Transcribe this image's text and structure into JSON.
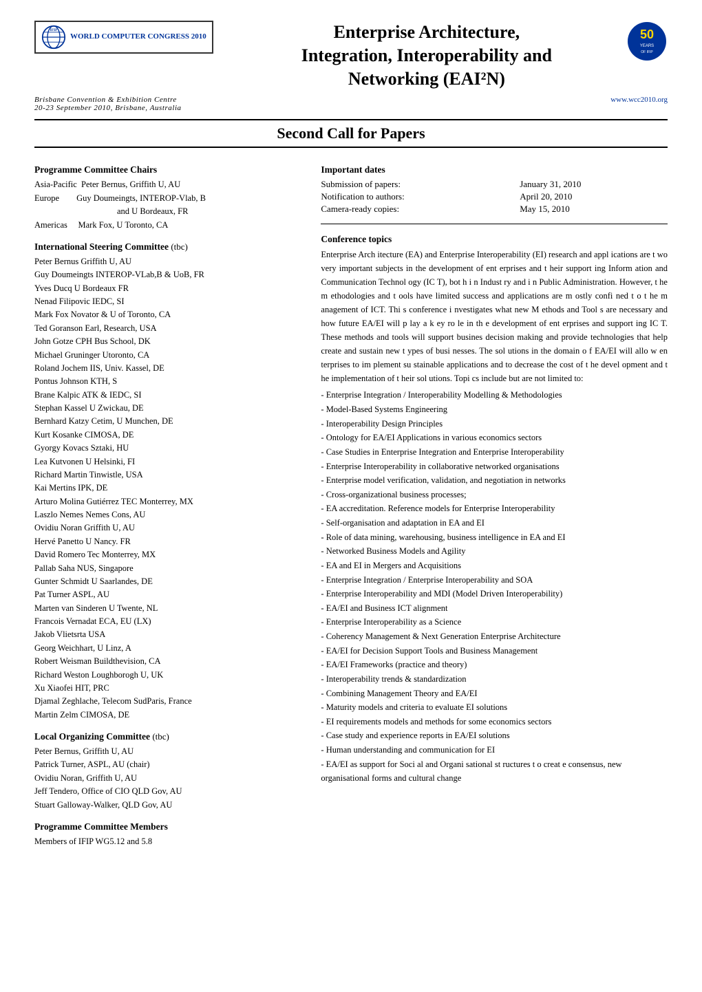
{
  "header": {
    "ifip_label": "IFIP",
    "congress_title": "WORLD COMPUTER CONGRESS 2010",
    "main_title_line1": "Enterprise Architecture,",
    "main_title_line2": "Integration, Interoperability and",
    "main_title_line3": "Networking (EAI²N)",
    "venue_line1": "Brisbane Convention & Exhibition Centre",
    "venue_line2": "20-23 September 2010, Brisbane, Australia",
    "website": "www.wcc2010.org"
  },
  "second_call": {
    "heading": "Second Call for Papers"
  },
  "programme_chairs": {
    "heading": "Programme Committee Chairs",
    "members": [
      "Asia-Pacific  Peter Bernus, Griffith U, AU",
      "Europe        Guy Doumeingts, INTEROP-Vlab, B",
      "              and U Bordeaux, FR",
      "Americas      Mark Fox, U Toronto, CA"
    ]
  },
  "steering_committee": {
    "heading": "International Steering Committee",
    "tbc": "(tbc)",
    "members": [
      "Peter Bernus Griffith U, AU",
      "Guy Doumeingts INTEROP-VLab,B & UoB, FR",
      "Yves Ducq U Bordeaux  FR",
      "Nenad Filipovic IEDC, SI",
      "Mark Fox Novator & U of Toronto, CA",
      "Ted Goranson Earl, Research, USA",
      "John Gotze CPH Bus School, DK",
      "Michael Gruninger Utoronto, CA",
      "Roland Jochem IIS, Univ. Kassel, DE",
      "Pontus Johnson  KTH,  S",
      "Brane Kalpic ATK & IEDC, SI",
      "Stephan Kassel U Zwickau, DE",
      "Bernhard Katzy Cetim, U Munchen, DE",
      "Kurt Kosanke CIMOSA, DE",
      "Gyorgy Kovacs Sztaki, HU",
      "Lea Kutvonen  U Helsinki,  FI",
      "Richard Martin Tinwistle, USA",
      "Kai Mertins IPK, DE",
      "Arturo Molina Gutiérrez TEC Monterrey, MX",
      "Laszlo Nemes Nemes Cons, AU",
      "Ovidiu Noran Griffith U, AU",
      "Hervé Panetto U Nancy. FR",
      "David Romero Tec Monterrey, MX",
      "Pallab Saha NUS, Singapore",
      "Gunter Schmidt U Saarlandes, DE",
      "Pat Turner ASPL, AU",
      "Marten van Sinderen U Twente,  NL",
      "Francois Vernadat ECA, EU (LX)",
      "Jakob Vlietsrta USA",
      "Georg Weichhart, U Linz, A",
      "Robert Weisman Buildthevision, CA",
      "Richard Weston Loughborogh U, UK",
      "Xu Xiaofei HIT, PRC",
      "Djamal Zeghlache, Telecom SudParis, France",
      "Martin Zelm CIMOSA, DE"
    ]
  },
  "local_committee": {
    "heading": "Local Organizing Committee",
    "tbc": "(tbc)",
    "members": [
      "Peter Bernus, Griffith U, AU",
      "Patrick Turner, ASPL, AU (chair)",
      "Ovidiu Noran, Griffith U, AU",
      "Jeff Tendero, Office of CIO QLD Gov, AU",
      "Stuart Galloway-Walker, QLD Gov, AU"
    ]
  },
  "programme_members": {
    "heading": "Programme Committee Members",
    "description": "Members of IFIP WG5.12 and 5.8"
  },
  "important_dates": {
    "heading": "Important dates",
    "rows": [
      {
        "label": "Submission of papers:",
        "value": "January 31, 2010"
      },
      {
        "label": "Notification to authors:",
        "value": "April 20, 2010"
      },
      {
        "label": "Camera-ready copies:",
        "value": "May 15, 2010"
      }
    ]
  },
  "conference_topics": {
    "heading": "Conference topics",
    "intro": "Enterprise Arch itecture (EA)  and Enterprise Interoperability (EI) research and appl ications are t wo very  important subjects in the development of ent erprises and t heir support ing Inform  ation and Communication Technol ogy (IC T), bot h i n Indust ry and i  n  Public Administration.  However, t he m ethodologies and t ools have  limited success  and applications are m ostly confi ned t o t he m anagement of ICT.  Thi s conference i nvestigates what new M ethods and Tool s are necessary  and how  future EA/EI will p  lay a k  ey ro le in  th e development of ent erprises and support ing IC T.  These methods and tools will support  busines decision making and provide technologies that help create and sustain new t ypes of busi nesses. The sol utions in the domain o f EA/EI will allo  w en terprises to  im plement su stainable applications and to decrease the     cost  of t he devel opment and t he implementation of t heir sol utions.  Topi cs include but are not limited to:",
    "topics": [
      "Enterprise Integration / Interoperability Modelling & Methodologies",
      "Model-Based Systems Engineering",
      "Interoperability Design Principles",
      "Ontology for EA/EI  Applications in various economics sectors",
      "Case Studies in Enterprise Integration and Enterprise Interoperability",
      "Enterprise Interoperability in collaborative networked organisations",
      "Enterprise model verification, validation, and negotiation in networks",
      "Cross-organizational business processes;",
      "EA accreditation.  Reference models for Enterprise Interoperability",
      "Self-organisation and adaptation in EA and EI",
      "Role of data mining, warehousing, business intelligence in EA and EI",
      "Networked Business Models and Agility",
      "EA and  EI in Mergers and Acquisitions",
      "Enterprise Integration / Enterprise Interoperability and SOA",
      "Enterprise Interoperability and MDI (Model Driven Interoperability)",
      "EA/EI and Business ICT  alignment",
      "Enterprise Interoperability as a Science",
      "Coherency Management & Next Generation Enterprise Architecture",
      "EA/EI for Decision Support Tools and Business Management",
      "EA/EI Frameworks (practice and theory)",
      "Interoperability trends & standardization",
      "Combining Management Theory and  EA/EI",
      "Maturity models and criteria to evaluate EI solutions",
      "EI requirements models and methods for some economics sectors",
      "Case study and experience reports  in EA/EI solutions",
      "Human understanding and communication for EI",
      "- EA/EI as support  for Soci al and Organi sational st ructures t o creat e consensus, new organisational forms and cultural change"
    ]
  }
}
